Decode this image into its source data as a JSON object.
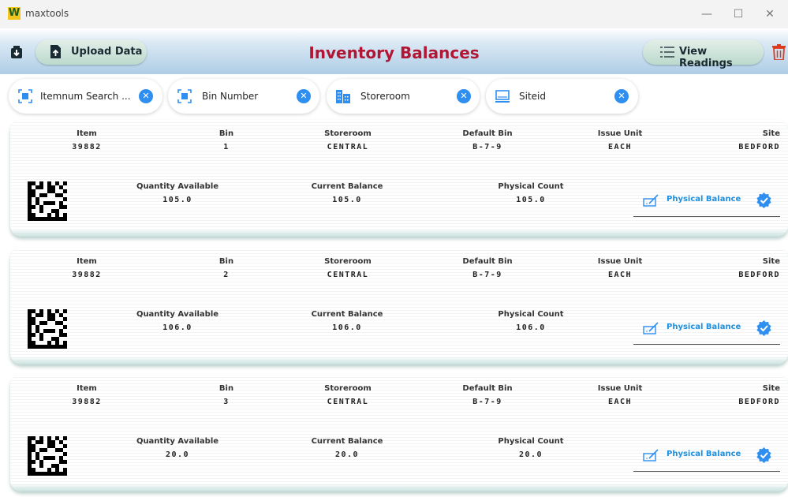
{
  "window": {
    "title": "maxtools",
    "logo_letter": "W"
  },
  "header": {
    "upload_label": "Upload Data",
    "title": "Inventory Balances",
    "view_label": "View Readings"
  },
  "filters": [
    {
      "label": "Itemnum Search ...",
      "icon": "scan-icon"
    },
    {
      "label": "Bin Number",
      "icon": "scan-icon"
    },
    {
      "label": "Storeroom",
      "icon": "building-icon"
    },
    {
      "label": "Siteid",
      "icon": "computer-icon"
    }
  ],
  "columns": {
    "item": "Item",
    "bin": "Bin",
    "storeroom": "Storeroom",
    "default_bin": "Default Bin",
    "issue_unit": "Issue Unit",
    "site": "Site",
    "qty": "Quantity Available",
    "current": "Current Balance",
    "physical": "Physical Count"
  },
  "physical_balance_label": "Physical Balance",
  "records": [
    {
      "item": "39882",
      "bin": "1",
      "storeroom": "CENTRAL",
      "default_bin": "B-7-9",
      "issue_unit": "EACH",
      "site": "BEDFORD",
      "qty": "105.0",
      "current": "105.0",
      "physical": "105.0"
    },
    {
      "item": "39882",
      "bin": "2",
      "storeroom": "CENTRAL",
      "default_bin": "B-7-9",
      "issue_unit": "EACH",
      "site": "BEDFORD",
      "qty": "106.0",
      "current": "106.0",
      "physical": "106.0"
    },
    {
      "item": "39882",
      "bin": "3",
      "storeroom": "CENTRAL",
      "default_bin": "B-7-9",
      "issue_unit": "EACH",
      "site": "BEDFORD",
      "qty": "20.0",
      "current": "20.0",
      "physical": "20.0"
    }
  ],
  "colors": {
    "title_red": "#b31535",
    "accent_blue": "#2e8ff0",
    "link_blue": "#1d8fe0"
  }
}
